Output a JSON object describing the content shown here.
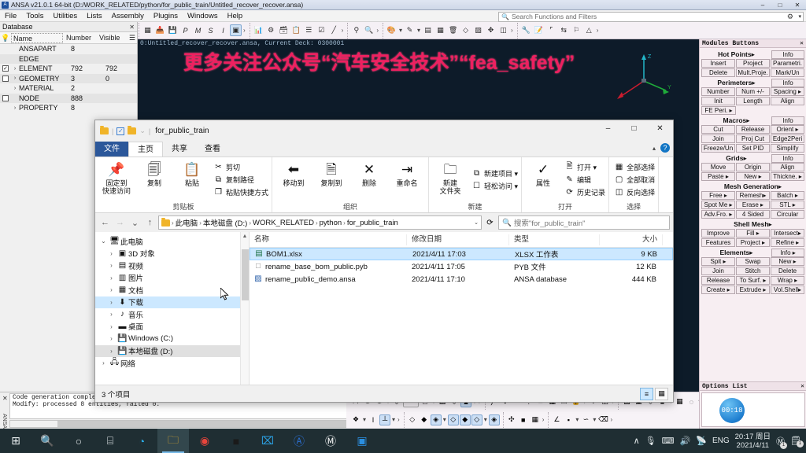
{
  "ansa": {
    "title": "ANSA v21.0.1 64-bit (D:/WORK_RELATED/python/for_public_train/Untitled_recover_recover.ansa)",
    "menu": [
      "File",
      "Tools",
      "Utilities",
      "Lists",
      "Assembly",
      "Plugins",
      "Windows",
      "Help"
    ],
    "search_placeholder": "Search Functions and Filters",
    "win_min": "–",
    "win_max": "□",
    "win_close": "✕",
    "database": {
      "title": "Database",
      "close": "✕",
      "columns": {
        "name": "Name",
        "number": "Number",
        "visible": "Visible"
      },
      "rows": [
        {
          "check": "",
          "arrow": "",
          "name": "ANSAPART",
          "number": "8",
          "visible": ""
        },
        {
          "check": "",
          "arrow": "",
          "name": "EDGE",
          "number": "",
          "visible": ""
        },
        {
          "check": "✓",
          "arrow": "›",
          "name": "ELEMENT",
          "number": "792",
          "visible": "792"
        },
        {
          "check": " ",
          "arrow": "›",
          "name": "GEOMETRY",
          "number": "3",
          "visible": "0"
        },
        {
          "check": "",
          "arrow": "›",
          "name": "MATERIAL",
          "number": "2",
          "visible": ""
        },
        {
          "check": " ",
          "arrow": "",
          "name": "NODE",
          "number": "888",
          "visible": ""
        },
        {
          "check": "",
          "arrow": "›",
          "name": "PROPERTY",
          "number": "8",
          "visible": ""
        }
      ]
    },
    "viewport": {
      "status": "0:Untitled_recover_recover.ansa,   Current Deck: 0300001",
      "watermark": "更多关注公众号“汽车安全技术”“fea_safety”",
      "axis": {
        "x": "X",
        "y": "Y",
        "z": "Z"
      }
    },
    "console": {
      "line1": "Code generation completed",
      "line2": "Modify: processed 8 entities, failed 0."
    },
    "modules": {
      "title": "Modules Buttons",
      "close": "✕",
      "sections": [
        {
          "title": "Hot Points▸",
          "info": "Info",
          "rows": [
            [
              "Insert",
              "Project",
              "Parametri."
            ],
            [
              "Delete",
              "Mult.Proje.",
              "Mark/Un"
            ]
          ]
        },
        {
          "title": "Perimeters▸",
          "info": "Info",
          "rows": [
            [
              "Number",
              "Num +/-",
              "Spacing ▸"
            ],
            [
              "Init",
              "Length",
              "Align"
            ],
            [
              "FE Peri. ▸"
            ]
          ]
        },
        {
          "title": "Macros▸",
          "info": "Info",
          "rows": [
            [
              "Cut",
              "Release",
              "Orient ▸"
            ],
            [
              "Join",
              "Proj Cut",
              "Edge2Peri"
            ],
            [
              "Freeze/Un",
              "Set PID",
              "Simplify"
            ]
          ]
        },
        {
          "title": "Grids▸",
          "info": "Info",
          "rows": [
            [
              "Move",
              "Origin",
              "Align"
            ],
            [
              "Paste ▸",
              "New ▸",
              "Thickne. ▸"
            ]
          ]
        },
        {
          "title": "Mesh Generation▸",
          "info": "",
          "rows": [
            [
              "Free ▸",
              "Remesh▸",
              "Batch ▸"
            ],
            [
              "Spot Me ▸",
              "Erase ▸",
              "STL ▸"
            ],
            [
              "Adv.Fro. ▸",
              "4 Sided",
              "Circular"
            ]
          ]
        },
        {
          "title": "Shell Mesh▸",
          "info": "",
          "rows": [
            [
              "Improve",
              "Fill ▸",
              "Intersect▸"
            ],
            [
              "Features",
              "Project ▸",
              "Refine ▸"
            ]
          ]
        },
        {
          "title": "Elements▸",
          "info": "Info ▸",
          "rows": [
            [
              "Spit ▸",
              "Swap",
              "New ▸"
            ],
            [
              "Join",
              "Stitch",
              "Delete"
            ],
            [
              "Release",
              "To Surf. ▸",
              "Wrap ▸"
            ],
            [
              "Create ▸",
              "Extrude ▸",
              "Vol.Shell▸"
            ]
          ]
        }
      ],
      "options_title": "Options List",
      "timer": "00:18"
    }
  },
  "explorer": {
    "quick_access": {
      "folder": "folder-icon",
      "check": "✓",
      "dropdown": "⌄"
    },
    "title": "for_public_train",
    "win_min": "–",
    "win_max": "□",
    "win_close": "✕",
    "tabs": [
      {
        "label": "文件",
        "kind": "file"
      },
      {
        "label": "主页",
        "kind": "active"
      },
      {
        "label": "共享",
        "kind": ""
      },
      {
        "label": "查看",
        "kind": ""
      }
    ],
    "ribbon": [
      {
        "group": "剪贴板",
        "big": [
          {
            "label": "固定到\n快速访问",
            "icon": "📌"
          },
          {
            "label": "复制",
            "icon": "🗐"
          },
          {
            "label": "粘贴",
            "icon": "📋"
          }
        ],
        "small": [
          {
            "label": "剪切",
            "icon": "✂"
          },
          {
            "label": "复制路径",
            "icon": "⧉"
          },
          {
            "label": "粘贴快捷方式",
            "icon": "❐"
          }
        ]
      },
      {
        "group": "组织",
        "big": [
          {
            "label": "移动到",
            "icon": "⬅"
          },
          {
            "label": "复制到",
            "icon": "🗎"
          },
          {
            "label": "删除",
            "icon": "✕"
          },
          {
            "label": "重命名",
            "icon": "⇥"
          }
        ],
        "small": []
      },
      {
        "group": "新建",
        "big": [
          {
            "label": "新建\n文件夹",
            "icon": "🗀"
          }
        ],
        "small": [
          {
            "label": "新建项目 ▾",
            "icon": "⧉"
          },
          {
            "label": "轻松访问 ▾",
            "icon": "☐"
          }
        ]
      },
      {
        "group": "打开",
        "big": [
          {
            "label": "属性",
            "icon": "✓"
          }
        ],
        "small": [
          {
            "label": "打开 ▾",
            "icon": "🖹"
          },
          {
            "label": "编辑",
            "icon": "✎"
          },
          {
            "label": "历史记录",
            "icon": "⟳"
          }
        ]
      },
      {
        "group": "选择",
        "big": [],
        "small": [
          {
            "label": "全部选择",
            "icon": "▦"
          },
          {
            "label": "全部取消",
            "icon": "▢"
          },
          {
            "label": "反向选择",
            "icon": "◫"
          }
        ]
      }
    ],
    "nav": {
      "back": "←",
      "forward": "→",
      "recent": "⌄",
      "up": "↑",
      "refresh": "⟳"
    },
    "breadcrumb": [
      "此电脑",
      "本地磁盘 (D:)",
      "WORK_RELATED",
      "python",
      "for_public_train"
    ],
    "search_placeholder": "搜索\"for_public_train\"",
    "tree": [
      {
        "label": "此电脑",
        "icon": "🖥",
        "twisty": "⌄",
        "level": 1,
        "state": ""
      },
      {
        "label": "3D 对象",
        "icon": "▣",
        "twisty": "›",
        "level": 2,
        "state": ""
      },
      {
        "label": "视频",
        "icon": "▤",
        "twisty": "›",
        "level": 2,
        "state": ""
      },
      {
        "label": "图片",
        "icon": "▥",
        "twisty": "›",
        "level": 2,
        "state": ""
      },
      {
        "label": "文档",
        "icon": "▦",
        "twisty": "›",
        "level": 2,
        "state": ""
      },
      {
        "label": "下载",
        "icon": "⬇",
        "twisty": "›",
        "level": 2,
        "state": "sel"
      },
      {
        "label": "音乐",
        "icon": "♪",
        "twisty": "›",
        "level": 2,
        "state": ""
      },
      {
        "label": "桌面",
        "icon": "▬",
        "twisty": "›",
        "level": 2,
        "state": ""
      },
      {
        "label": "Windows (C:)",
        "icon": "💾",
        "twisty": "›",
        "level": 2,
        "state": ""
      },
      {
        "label": "本地磁盘 (D:)",
        "icon": "💾",
        "twisty": "›",
        "level": 2,
        "state": "sel2"
      },
      {
        "label": "网络",
        "icon": "🖧",
        "twisty": "›",
        "level": 1,
        "state": ""
      }
    ],
    "list_columns": [
      "名称",
      "修改日期",
      "类型",
      "大小"
    ],
    "files": [
      {
        "name": "BOM1.xlsx",
        "date": "2021/4/11 17:03",
        "type": "XLSX 工作表",
        "size": "9 KB",
        "icon": "▤",
        "color": "#1d7044",
        "selected": true
      },
      {
        "name": "rename_base_bom_public.pyb",
        "date": "2021/4/11 17:05",
        "type": "PYB 文件",
        "size": "12 KB",
        "icon": "□",
        "color": "#888888",
        "selected": false
      },
      {
        "name": "rename_public_demo.ansa",
        "date": "2021/4/11 17:10",
        "type": "ANSA database",
        "size": "444 KB",
        "icon": "▨",
        "color": "#2a5fa8",
        "selected": false
      }
    ],
    "status": "3 个项目",
    "view_buttons": [
      "≡",
      "▦"
    ]
  },
  "taskbar": {
    "items": [
      {
        "name": "start-button",
        "icon": "⊞"
      },
      {
        "name": "search-button",
        "icon": "🔍"
      },
      {
        "name": "cortana-button",
        "icon": "○"
      },
      {
        "name": "task-view-button",
        "icon": "⌸"
      },
      {
        "name": "edge-app",
        "icon": "◔"
      },
      {
        "name": "file-explorer-app",
        "icon": "🗀"
      },
      {
        "name": "chrome-app",
        "icon": "◉"
      },
      {
        "name": "terminal-app",
        "icon": "■"
      },
      {
        "name": "vscode-app",
        "icon": "⌧"
      },
      {
        "name": "ansa-app",
        "icon": "Ⓐ"
      },
      {
        "name": "meta-app",
        "icon": "Ⓜ"
      },
      {
        "name": "display-app",
        "icon": "▣"
      }
    ],
    "tray": {
      "chevron": "∧",
      "icons": [
        "🎙",
        "⌨",
        "🔊",
        "📡"
      ],
      "language": "ENG",
      "time": "20:17 周日",
      "date": "2021/4/11",
      "notify": "🗒"
    }
  }
}
